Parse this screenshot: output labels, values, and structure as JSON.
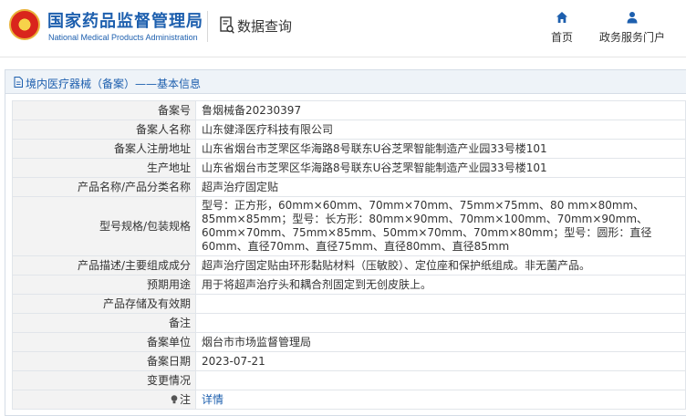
{
  "header": {
    "org_name_cn": "国家药品监督管理局",
    "org_name_en": "National Medical Products Administration",
    "section_title": "数据查询",
    "nav": [
      {
        "label": "首页",
        "icon": "home-icon"
      },
      {
        "label": "政务服务门户",
        "icon": "person-icon"
      }
    ]
  },
  "breadcrumb": "境内医疗器械（备案）——基本信息",
  "colors": {
    "brand_blue": "#1d5fae",
    "label_bg": "#f3f3f3",
    "crumb_bg": "#eef3f8"
  },
  "rows": [
    {
      "label": "备案号",
      "value": "鲁烟械备20230397"
    },
    {
      "label": "备案人名称",
      "value": "山东健泽医疗科技有限公司"
    },
    {
      "label": "备案人注册地址",
      "value": "山东省烟台市芝罘区华海路8号联东U谷芝罘智能制造产业园33号楼101"
    },
    {
      "label": "生产地址",
      "value": "山东省烟台市芝罘区华海路8号联东U谷芝罘智能制造产业园33号楼101"
    },
    {
      "label": "产品名称/产品分类名称",
      "value": "超声治疗固定贴"
    },
    {
      "label": "型号规格/包装规格",
      "value": "型号：正方形，60mm×60mm、70mm×70mm、75mm×75mm、80 mm×80mm、85mm×85mm；型号：长方形：80mm×90mm、70mm×100mm、70mm×90mm、60mm×70mm、75mm×85mm、50mm×70mm、70mm×80mm；型号：圆形：直径60mm、直径70mm、直径75mm、直径80mm、直径85mm"
    },
    {
      "label": "产品描述/主要组成成分",
      "value": "超声治疗固定贴由环形黏贴材料（压敏胶）、定位座和保护纸组成。非无菌产品。"
    },
    {
      "label": "预期用途",
      "value": "用于将超声治疗头和耦合剂固定到无创皮肤上。"
    },
    {
      "label": "产品存储及有效期",
      "value": ""
    },
    {
      "label": "备注",
      "value": ""
    },
    {
      "label": "备案单位",
      "value": "烟台市市场监督管理局"
    },
    {
      "label": "备案日期",
      "value": "2023-07-21"
    },
    {
      "label": "变更情况",
      "value": ""
    },
    {
      "label": "注",
      "value": "详情"
    }
  ]
}
